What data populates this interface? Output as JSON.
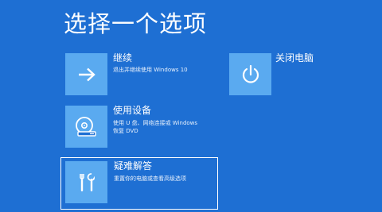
{
  "screen": {
    "title": "选择一个选项"
  },
  "options": {
    "continue": {
      "label": "继续",
      "description": "退出并继续使用 Windows 10",
      "icon": "arrow-right-icon"
    },
    "use_device": {
      "label": "使用设备",
      "description": "使用 U 盘、网络连接或 Windows 恢复 DVD",
      "icon": "disc-drive-icon"
    },
    "troubleshoot": {
      "label": "疑难解答",
      "description": "重置你的电脑或查看高级选项",
      "icon": "tools-icon"
    },
    "shutdown": {
      "label": "关闭电脑",
      "icon": "power-icon"
    }
  },
  "colors": {
    "background": "#1e6fd3",
    "tile": "#5aaaf0",
    "text": "#ffffff"
  }
}
